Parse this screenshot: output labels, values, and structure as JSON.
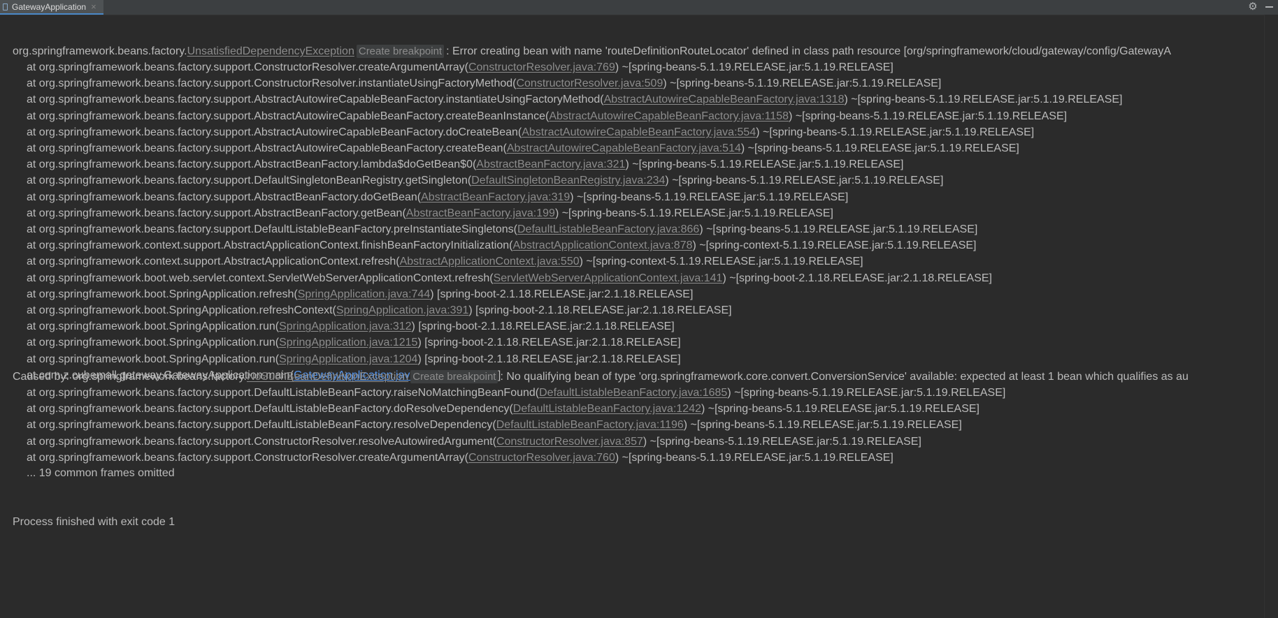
{
  "tab": {
    "title": "GatewayApplication",
    "close": "×"
  },
  "toolbar": {
    "settings_icon": "gear-icon",
    "minimize_icon": "minimize-icon"
  },
  "exception_line": {
    "prefix": "org.springframework.beans.factory.",
    "link": "UnsatisfiedDependencyException",
    "breakpoint": "Create breakpoint",
    "message": ": Error creating bean with name 'routeDefinitionRouteLocator' defined in class path resource [org/springframework/cloud/gateway/config/GatewayA"
  },
  "stack1": [
    {
      "pre": "at org.springframework.beans.factory.support.ConstructorResolver.createArgumentArray(",
      "link": "ConstructorResolver.java:769",
      "post": ") ~[spring-beans-5.1.19.RELEASE.jar:5.1.19.RELEASE]"
    },
    {
      "pre": "at org.springframework.beans.factory.support.ConstructorResolver.instantiateUsingFactoryMethod(",
      "link": "ConstructorResolver.java:509",
      "post": ") ~[spring-beans-5.1.19.RELEASE.jar:5.1.19.RELEASE]"
    },
    {
      "pre": "at org.springframework.beans.factory.support.AbstractAutowireCapableBeanFactory.instantiateUsingFactoryMethod(",
      "link": "AbstractAutowireCapableBeanFactory.java:1318",
      "post": ") ~[spring-beans-5.1.19.RELEASE.jar:5.1.19.RELEASE]"
    },
    {
      "pre": "at org.springframework.beans.factory.support.AbstractAutowireCapableBeanFactory.createBeanInstance(",
      "link": "AbstractAutowireCapableBeanFactory.java:1158",
      "post": ") ~[spring-beans-5.1.19.RELEASE.jar:5.1.19.RELEASE]"
    },
    {
      "pre": "at org.springframework.beans.factory.support.AbstractAutowireCapableBeanFactory.doCreateBean(",
      "link": "AbstractAutowireCapableBeanFactory.java:554",
      "post": ") ~[spring-beans-5.1.19.RELEASE.jar:5.1.19.RELEASE]"
    },
    {
      "pre": "at org.springframework.beans.factory.support.AbstractAutowireCapableBeanFactory.createBean(",
      "link": "AbstractAutowireCapableBeanFactory.java:514",
      "post": ") ~[spring-beans-5.1.19.RELEASE.jar:5.1.19.RELEASE]"
    },
    {
      "pre": "at org.springframework.beans.factory.support.AbstractBeanFactory.lambda$doGetBean$0(",
      "link": "AbstractBeanFactory.java:321",
      "post": ") ~[spring-beans-5.1.19.RELEASE.jar:5.1.19.RELEASE]"
    },
    {
      "pre": "at org.springframework.beans.factory.support.DefaultSingletonBeanRegistry.getSingleton(",
      "link": "DefaultSingletonBeanRegistry.java:234",
      "post": ") ~[spring-beans-5.1.19.RELEASE.jar:5.1.19.RELEASE]"
    },
    {
      "pre": "at org.springframework.beans.factory.support.AbstractBeanFactory.doGetBean(",
      "link": "AbstractBeanFactory.java:319",
      "post": ") ~[spring-beans-5.1.19.RELEASE.jar:5.1.19.RELEASE]"
    },
    {
      "pre": "at org.springframework.beans.factory.support.AbstractBeanFactory.getBean(",
      "link": "AbstractBeanFactory.java:199",
      "post": ") ~[spring-beans-5.1.19.RELEASE.jar:5.1.19.RELEASE]"
    },
    {
      "pre": "at org.springframework.beans.factory.support.DefaultListableBeanFactory.preInstantiateSingletons(",
      "link": "DefaultListableBeanFactory.java:866",
      "post": ") ~[spring-beans-5.1.19.RELEASE.jar:5.1.19.RELEASE]"
    },
    {
      "pre": "at org.springframework.context.support.AbstractApplicationContext.finishBeanFactoryInitialization(",
      "link": "AbstractApplicationContext.java:878",
      "post": ") ~[spring-context-5.1.19.RELEASE.jar:5.1.19.RELEASE]"
    },
    {
      "pre": "at org.springframework.context.support.AbstractApplicationContext.refresh(",
      "link": "AbstractApplicationContext.java:550",
      "post": ") ~[spring-context-5.1.19.RELEASE.jar:5.1.19.RELEASE]"
    },
    {
      "pre": "at org.springframework.boot.web.servlet.context.ServletWebServerApplicationContext.refresh(",
      "link": "ServletWebServerApplicationContext.java:141",
      "post": ") ~[spring-boot-2.1.18.RELEASE.jar:2.1.18.RELEASE]"
    },
    {
      "pre": "at org.springframework.boot.SpringApplication.refresh(",
      "link": "SpringApplication.java:744",
      "post": ") [spring-boot-2.1.18.RELEASE.jar:2.1.18.RELEASE]"
    },
    {
      "pre": "at org.springframework.boot.SpringApplication.refreshContext(",
      "link": "SpringApplication.java:391",
      "post": ") [spring-boot-2.1.18.RELEASE.jar:2.1.18.RELEASE]"
    },
    {
      "pre": "at org.springframework.boot.SpringApplication.run(",
      "link": "SpringApplication.java:312",
      "post": ") [spring-boot-2.1.18.RELEASE.jar:2.1.18.RELEASE]"
    },
    {
      "pre": "at org.springframework.boot.SpringApplication.run(",
      "link": "SpringApplication.java:1215",
      "post": ") [spring-boot-2.1.18.RELEASE.jar:2.1.18.RELEASE]"
    },
    {
      "pre": "at org.springframework.boot.SpringApplication.run(",
      "link": "SpringApplication.java:1204",
      "post": ") [spring-boot-2.1.18.RELEASE.jar:2.1.18.RELEASE]"
    },
    {
      "pre": "at com.z.cubemall.gateway.GatewayApplication.main(",
      "link": "GatewayApplication.java:13",
      "post": ") [classes/:na]",
      "user": true
    }
  ],
  "caused_line": {
    "prefix": "Caused by: org.springframework.beans.factory.",
    "link": "NoSuchBeanDefinitionException",
    "breakpoint": "Create breakpoint",
    "message": ": No qualifying bean of type 'org.springframework.core.convert.ConversionService' available: expected at least 1 bean which qualifies as au"
  },
  "stack2": [
    {
      "pre": "at org.springframework.beans.factory.support.DefaultListableBeanFactory.raiseNoMatchingBeanFound(",
      "link": "DefaultListableBeanFactory.java:1685",
      "post": ") ~[spring-beans-5.1.19.RELEASE.jar:5.1.19.RELEASE]"
    },
    {
      "pre": "at org.springframework.beans.factory.support.DefaultListableBeanFactory.doResolveDependency(",
      "link": "DefaultListableBeanFactory.java:1242",
      "post": ") ~[spring-beans-5.1.19.RELEASE.jar:5.1.19.RELEASE]"
    },
    {
      "pre": "at org.springframework.beans.factory.support.DefaultListableBeanFactory.resolveDependency(",
      "link": "DefaultListableBeanFactory.java:1196",
      "post": ") ~[spring-beans-5.1.19.RELEASE.jar:5.1.19.RELEASE]"
    },
    {
      "pre": "at org.springframework.beans.factory.support.ConstructorResolver.resolveAutowiredArgument(",
      "link": "ConstructorResolver.java:857",
      "post": ") ~[spring-beans-5.1.19.RELEASE.jar:5.1.19.RELEASE]"
    },
    {
      "pre": "at org.springframework.beans.factory.support.ConstructorResolver.createArgumentArray(",
      "link": "ConstructorResolver.java:760",
      "post": ") ~[spring-beans-5.1.19.RELEASE.jar:5.1.19.RELEASE]"
    }
  ],
  "omitted": "... 19 common frames omitted",
  "finished": "Process finished with exit code 1"
}
